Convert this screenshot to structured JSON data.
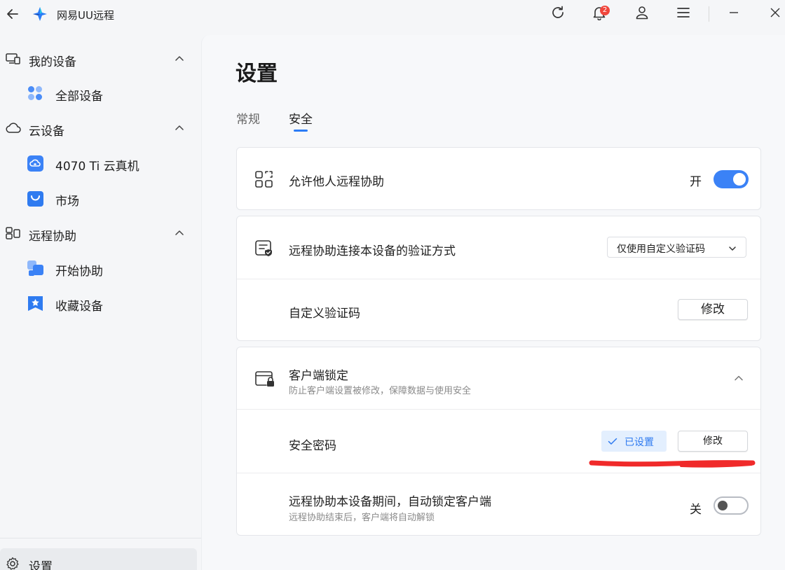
{
  "app": {
    "title": "网易UU远程"
  },
  "titlebar": {
    "notification_count": "2"
  },
  "sidebar": {
    "groups": [
      {
        "label": "我的设备",
        "items": [
          {
            "label": "全部设备"
          }
        ]
      },
      {
        "label": "云设备",
        "items": [
          {
            "label": "4070 Ti 云真机"
          },
          {
            "label": "市场"
          }
        ]
      },
      {
        "label": "远程协助",
        "items": [
          {
            "label": "开始协助"
          },
          {
            "label": "收藏设备"
          }
        ]
      }
    ],
    "settings_label": "设置"
  },
  "main": {
    "title": "设置",
    "tabs": [
      {
        "label": "常规",
        "active": false
      },
      {
        "label": "安全",
        "active": true
      }
    ],
    "allow_assist": {
      "label": "允许他人远程协助",
      "state_label": "开",
      "enabled": true
    },
    "verification": {
      "label": "远程协助连接本设备的验证方式",
      "selected": "仅使用自定义验证码",
      "custom_code_label": "自定义验证码",
      "modify_label": "修改"
    },
    "client_lock": {
      "title": "客户端锁定",
      "subtitle": "防止客户端设置被修改，保障数据与使用安全",
      "password_label": "安全密码",
      "password_status": "已设置",
      "modify_label": "修改",
      "auto_lock_label": "远程协助本设备期间，自动锁定客户端",
      "auto_lock_sub": "远程协助结束后，客户端将自动解锁",
      "auto_lock_state_label": "关",
      "auto_lock_enabled": false
    }
  },
  "colors": {
    "accent": "#2b7cf6",
    "toggle_on": "#3b82f6",
    "annotation": "#f02a2a"
  }
}
